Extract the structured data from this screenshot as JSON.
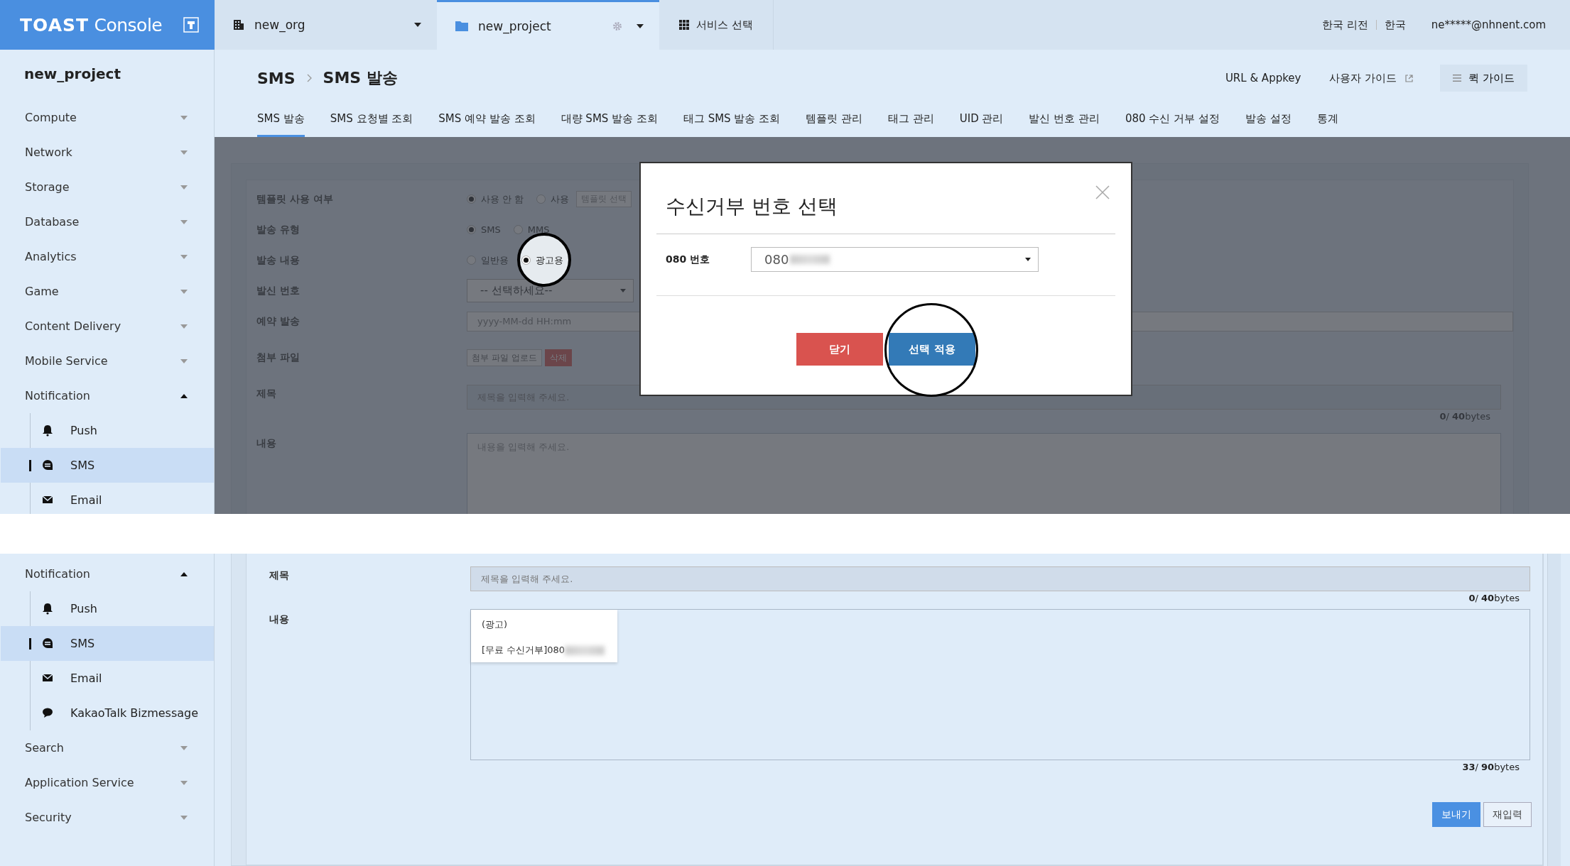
{
  "header": {
    "logo": "**TOAST** Console",
    "org": "new_org",
    "project": "new_project",
    "service_menu": "서비스 선택",
    "region": "한국 리전",
    "language": "한국",
    "user": "ne*****@nhnent.com"
  },
  "top_view": {
    "sidebar": {
      "title": "new_project",
      "items": [
        {
          "label": "Compute",
          "expanded": false
        },
        {
          "label": "Network",
          "expanded": false
        },
        {
          "label": "Storage",
          "expanded": false
        },
        {
          "label": "Database",
          "expanded": false
        },
        {
          "label": "Analytics",
          "expanded": false
        },
        {
          "label": "Game",
          "expanded": false
        },
        {
          "label": "Content Delivery",
          "expanded": false
        },
        {
          "label": "Mobile Service",
          "expanded": false
        },
        {
          "label": "Notification",
          "expanded": true,
          "children": [
            {
              "label": "Push",
              "kind": "push",
              "selected": false
            },
            {
              "label": "SMS",
              "kind": "sms",
              "selected": true
            },
            {
              "label": "Email",
              "kind": "email",
              "selected": false
            }
          ]
        }
      ]
    },
    "breadcrumb": [
      "SMS",
      "SMS 발송"
    ],
    "links": [
      {
        "label": "URL & Appkey",
        "external": false
      },
      {
        "label": "사용자 가이드",
        "external": true
      }
    ],
    "quick_guide": "퀵 가이드",
    "tabs": [
      {
        "label": "SMS 발송",
        "selected": true
      },
      {
        "label": "SMS 요청별 조회",
        "selected": false
      },
      {
        "label": "SMS 예약 발송 조회",
        "selected": false
      },
      {
        "label": "대량 SMS 발송 조회",
        "selected": false
      },
      {
        "label": "태그 SMS 발송 조회",
        "selected": false
      },
      {
        "label": "템플릿 관리",
        "selected": false
      },
      {
        "label": "태그 관리",
        "selected": false
      },
      {
        "label": "UID 관리",
        "selected": false
      },
      {
        "label": "발신 번호 관리",
        "selected": false
      },
      {
        "label": "080 수신 거부 설정",
        "selected": false
      },
      {
        "label": "발송 설정",
        "selected": false
      },
      {
        "label": "통계",
        "selected": false
      }
    ],
    "form": {
      "dimmed": true,
      "rows": [
        {
          "kind": "radio",
          "label": "템플릿 사용 여부",
          "options": [
            {
              "label": "사용 안 함",
              "selected": true,
              "spotlight": false
            },
            {
              "label": "사용",
              "selected": false,
              "spotlight": false
            }
          ],
          "field": {
            "placeholder": "템플릿 선택"
          }
        },
        {
          "kind": "radio",
          "label": "발송 유형",
          "options": [
            {
              "label": "SMS",
              "selected": true,
              "spotlight": false
            },
            {
              "label": "MMS",
              "selected": false,
              "spotlight": false
            }
          ]
        },
        {
          "kind": "radio",
          "label": "발송 내용",
          "options": [
            {
              "label": "일반용",
              "selected": false,
              "spotlight": false
            },
            {
              "label": "광고용",
              "selected": true,
              "spotlight": true
            }
          ]
        },
        {
          "kind": "select",
          "label": "발신 번호",
          "value": "-- 선택하세요--"
        },
        {
          "kind": "input",
          "label": "예약 발송",
          "placeholder": "yyyy-MM-dd HH:mm"
        },
        {
          "kind": "file",
          "label": "첨부 파일",
          "upload": "첨부 파일 업로드",
          "delete": "삭제"
        },
        {
          "kind": "text",
          "label": "제목",
          "placeholder": "제목을 입력해 주세요.",
          "counter": "**0**/ **40**bytes"
        },
        {
          "kind": "textarea",
          "label": "내용",
          "placeholder": "내용을 입력해 주세요."
        }
      ]
    },
    "dialog": {
      "title": "수신거부 번호 선택",
      "field_label": "080 번호",
      "value": "080",
      "buttons": [
        {
          "label": "닫기",
          "kind": "cancel",
          "spotlight": false
        },
        {
          "label": "선택 적용",
          "kind": "primary",
          "spotlight": true
        }
      ]
    }
  },
  "bottom_view": {
    "sidebar": {
      "items": [
        {
          "label": "Notification",
          "expanded": true,
          "children": [
            {
              "label": "Push",
              "kind": "push",
              "selected": false
            },
            {
              "label": "SMS",
              "kind": "sms",
              "selected": true
            },
            {
              "label": "Email",
              "kind": "email",
              "selected": false
            },
            {
              "label": "KakaoTalk Bizmessage",
              "kind": "kakaotalk",
              "selected": false
            }
          ]
        },
        {
          "label": "Search",
          "expanded": false
        },
        {
          "label": "Application Service",
          "expanded": false
        },
        {
          "label": "Security",
          "expanded": false
        }
      ]
    },
    "form": {
      "rows": [
        {
          "kind": "text",
          "label": "제목",
          "placeholder": "제목을 입력해 주세요.",
          "counter": "**0**/ **40**bytes"
        },
        {
          "kind": "textarea",
          "label": "내용",
          "lines": [
            "(광고)",
            "[무료 수신거부]080"
          ],
          "counter": "**33**/ **90**bytes"
        }
      ]
    },
    "actions": [
      {
        "label": "보내기",
        "kind": "primary"
      },
      {
        "label": "재입력",
        "kind": "default"
      }
    ]
  }
}
